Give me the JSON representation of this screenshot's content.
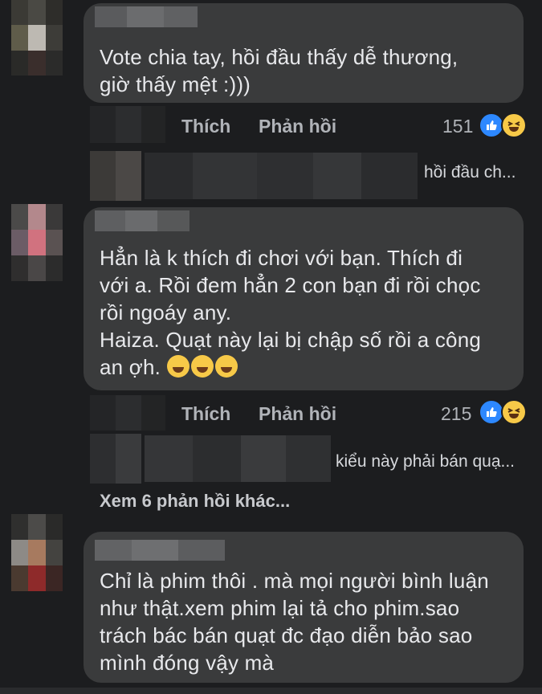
{
  "comments": [
    {
      "text": "Vote chia tay, hồi đầu thấy dễ thương,\ngiờ thấy mệt :)))",
      "like_label": "Thích",
      "reply_label": "Phản hồi",
      "reaction_count": "151",
      "reply_preview": "hồi đầu ch..."
    },
    {
      "text": "Hẳn là k thích đi chơi với bạn. Thích đi\nvới a. Rồi đem hẳn 2 con bạn đi rồi chọc\nrồi ngoáy any.\nHaiza. Quạt này lại bị chập số rồi a công\nan ợh.",
      "like_label": "Thích",
      "reply_label": "Phản hồi",
      "reaction_count": "215",
      "reply_preview": "kiểu này phải bán quạ...",
      "more_replies": "Xem 6 phản hồi khác..."
    },
    {
      "text": "Chỉ là phim thôi . mà mọi người bình luận\nnhư thật.xem phim lại tả cho phim.sao\ntrách bác bán quạt đc đạo diễn bảo sao\nmình đóng vậy mà"
    }
  ],
  "icons": [
    "like-reaction-icon",
    "haha-reaction-icon",
    "laughing-emoji-icon"
  ],
  "colors": {
    "background": "#1c1d1f",
    "bubble": "#3a3b3c",
    "like": "#2d88ff",
    "haha": "#f7c948"
  }
}
